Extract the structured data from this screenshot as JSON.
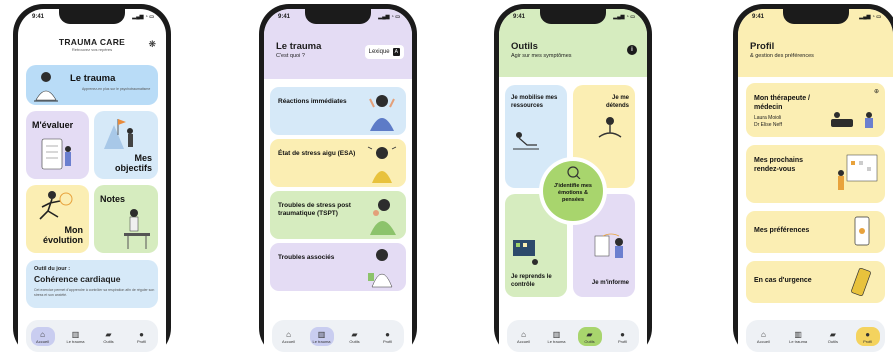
{
  "status_time": "9:41",
  "tabs": [
    "Accueil",
    "Le trauma",
    "Outils",
    "Profil"
  ],
  "phone1": {
    "brand": "TRAUMA CARE",
    "tagline": "Retrouvez vos repères",
    "trauma_card": {
      "title": "Le trauma",
      "subtitle": "Apprenez-en plus sur le psychotraumatisme"
    },
    "evaluate": "M'évaluer",
    "objectives": "Mes objectifs",
    "evolution": "Mon évolution",
    "notes": "Notes",
    "tool_of_day": {
      "label": "Outil du jour :",
      "title": "Cohérence cardiaque",
      "desc": "Cet exercice permet d'apprendre à contrôler sa respiration afin de réguler son stress et son anxiété."
    }
  },
  "phone2": {
    "title": "Le trauma",
    "subtitle": "C'est quoi ?",
    "lexicon": "Lexique",
    "rows": [
      "Réactions immédiates",
      "État de stress aigu (ESA)",
      "Troubles de stress post traumatique (TSPT)",
      "Troubles associés"
    ]
  },
  "phone3": {
    "title": "Outils",
    "subtitle": "Agir sur mes symptômes",
    "info_icon": "i",
    "tl": "Je mobilise mes ressources",
    "tr": "Je me détends",
    "center": "J'identifie mes émotions & pensées",
    "bl": "Je reprends le contrôle",
    "br": "Je m'informe"
  },
  "phone4": {
    "title": "Profil",
    "subtitle": "& gestion des préférences",
    "therapist": {
      "title": "Mon thérapeute / médecin",
      "name1": "Laura Moioli",
      "name2": "Dr Elise Neff"
    },
    "appointments": "Mes prochains rendez-vous",
    "preferences": "Mes préférences",
    "emergency": "En cas d'urgence"
  },
  "colors": {
    "blue": "#d6e9f8",
    "purple": "#e4dcf4",
    "yellow": "#fbeeb3",
    "green": "#d6ecbf",
    "bright_blue": "#b9dcf7",
    "center_green": "#a8d56d"
  }
}
